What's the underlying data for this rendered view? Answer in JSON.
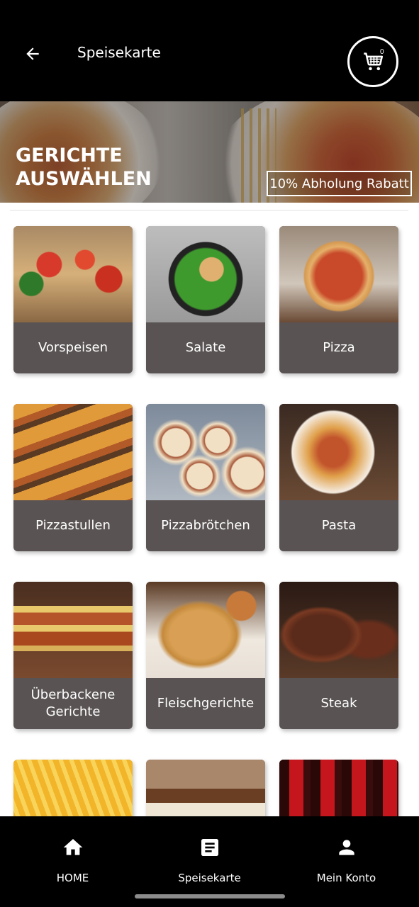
{
  "header": {
    "title": "Speisekarte",
    "cart_count": "0",
    "back_icon": "arrow-left-icon",
    "cart_icon": "shopping-cart-icon"
  },
  "banner": {
    "title_line1": "GERICHTE",
    "title_line2": "AUSWÄHLEN",
    "promo": "10% Abholung Rabatt"
  },
  "categories": [
    {
      "label": "Vorspeisen",
      "image": "bruschetta"
    },
    {
      "label": "Salate",
      "image": "chicken-salad"
    },
    {
      "label": "Pizza",
      "image": "pizza"
    },
    {
      "label": "Pizzastullen",
      "image": "pizza-baguettes"
    },
    {
      "label": "Pizzabrötchen",
      "image": "pizza-rolls"
    },
    {
      "label": "Pasta",
      "image": "spaghetti"
    },
    {
      "label": "Überbackene Gerichte",
      "image": "lasagna"
    },
    {
      "label": "Fleischgerichte",
      "image": "schnitzel"
    },
    {
      "label": "Steak",
      "image": "steak"
    },
    {
      "label": "",
      "image": "fries"
    },
    {
      "label": "",
      "image": "tiramisu"
    },
    {
      "label": "",
      "image": "cola-bottles"
    }
  ],
  "bottom_nav": [
    {
      "label": "HOME",
      "icon": "home-icon"
    },
    {
      "label": "Speisekarte",
      "icon": "menu-icon"
    },
    {
      "label": "Mein Konto",
      "icon": "account-icon"
    }
  ],
  "colors": {
    "header_bg": "#000000",
    "card_label_bg": "#595353",
    "text_light": "#ffffff"
  }
}
